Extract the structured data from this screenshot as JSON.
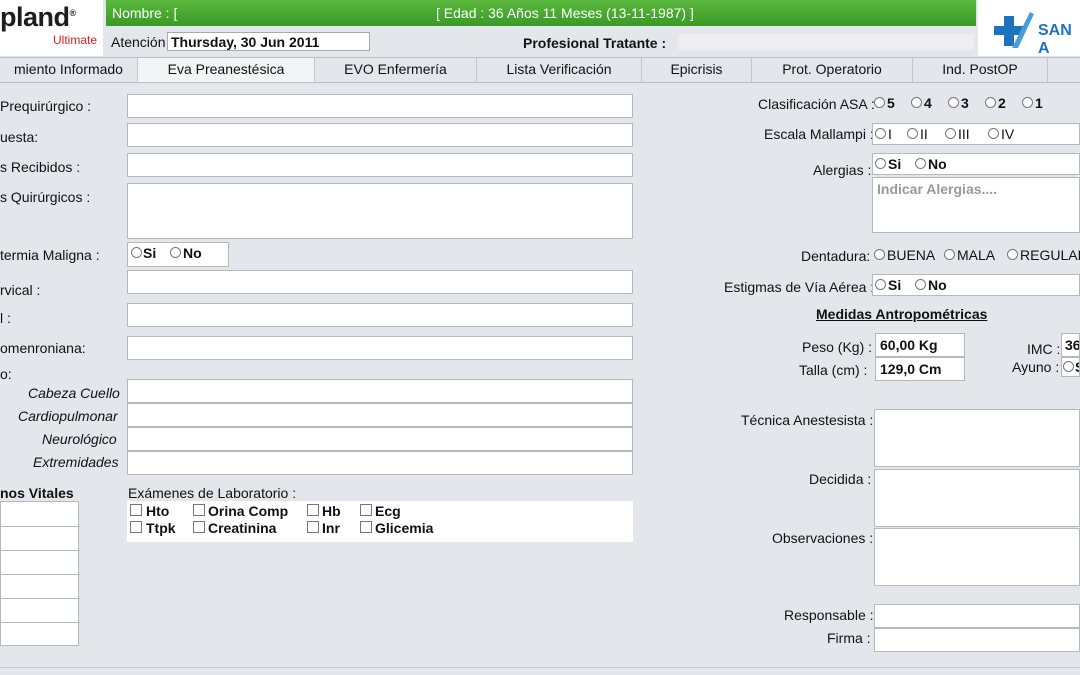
{
  "header": {
    "logo_text": "pland",
    "logo_reg": "®",
    "logo_sub": "Ultimate",
    "nombre_label": "Nombre : [",
    "edad_text": "[ Edad : 36 Años 11 Meses (13-11-1987) ]",
    "brand_text": "SAN A",
    "atencion_label": "Atención",
    "atencion_value": "Thursday, 30 Jun 2011",
    "profesional_label": "Profesional Tratante :"
  },
  "tabs": [
    {
      "label": "miento Informado",
      "active": false
    },
    {
      "label": "Eva Preanestésica",
      "active": true
    },
    {
      "label": "EVO Enfermería",
      "active": false
    },
    {
      "label": "Lista Verificación",
      "active": false
    },
    {
      "label": "Epicrisis",
      "active": false
    },
    {
      "label": "Prot. Operatorio",
      "active": false
    },
    {
      "label": "Ind. PostOP",
      "active": false
    }
  ],
  "left": {
    "prequirurgico": "Prequirúrgico :",
    "propuesta": "uesta:",
    "recibidos": "s Recibidos :",
    "quirurgicos": "s Quirúrgicos :",
    "hipertermia": "termia Maligna :",
    "hipertermia_si": "Si",
    "hipertermia_no": "No",
    "cervical": "rvical :",
    "l": "l :",
    "mallampati": "omenroniana:",
    "examen": "o:",
    "cabeza": "Cabeza Cuello",
    "cardio": "Cardiopulmonar",
    "neuro": "Neurológico",
    "extremidades": "Extremidades",
    "signos": "nos Vitales",
    "lab_title": "Exámenes de Laboratorio :",
    "lab": [
      "Hto",
      "Orina Comp",
      "Hb",
      "Ecg",
      "Ttpk",
      "Creatinina",
      "Inr",
      "Glicemia"
    ]
  },
  "right": {
    "asa_label": "Clasificación ASA :",
    "asa_opts": [
      "5",
      "4",
      "3",
      "2",
      "1"
    ],
    "mallampi_label": "Escala Mallampi :",
    "mallampi_opts": [
      "I",
      "II",
      "III",
      "IV"
    ],
    "alergias_label": "Alergias :",
    "alergias_si": "Si",
    "alergias_no": "No",
    "alergias_placeholder": "Indicar Alergias....",
    "dentadura_label": "Dentadura:",
    "dentadura_opts": [
      "BUENA",
      "MALA",
      "REGULAR"
    ],
    "estigmas_label": "Estigmas de Vía Aérea :",
    "estigmas_si": "Si",
    "estigmas_no": "No",
    "medidas_title": "Medidas Antropométricas",
    "peso_label": "Peso (Kg) :",
    "peso_value": "60,00 Kg",
    "talla_label": "Talla (cm) :",
    "talla_value": "129,0 Cm",
    "imc_label": "IMC :",
    "imc_value": "36",
    "ayuno_label": "Ayuno :",
    "ayuno_opt": "S",
    "tecnica_label": "Técnica Anestesista :",
    "decidida_label": "Decidida :",
    "observaciones_label": "Observaciones :",
    "responsable_label": "Responsable :",
    "firma_label": "Firma :"
  }
}
